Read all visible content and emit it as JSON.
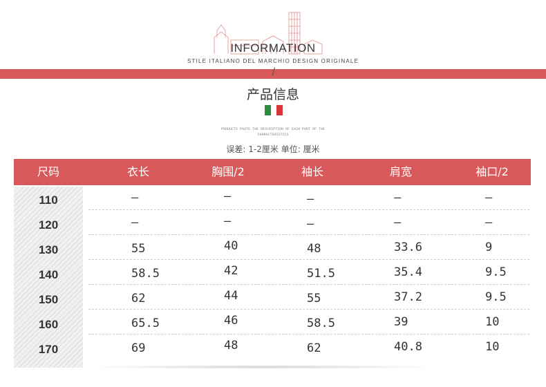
{
  "header": {
    "title": "INFORMATION",
    "subtitle": "STILE ITALIANO DEL MARCHIO DESIGN ORIGINALE",
    "slash": "/",
    "section_title": "产品信息",
    "fine_print_line1": "PRODUCTS PASTE THE DESCRIPTION OF EACH PART OF THE",
    "fine_print_line2": "CHARACTERISTICS",
    "tolerance_note": "误差: 1-2厘米  单位: 厘米",
    "flag_colors": [
      "#2e8b3e",
      "#ffffff",
      "#d6363a"
    ],
    "landmark_icon": "leaning-tower-landmark-icon"
  },
  "colors": {
    "accent": "#d9585a",
    "header_text": "#ffffff"
  },
  "table": {
    "columns": [
      "尺码",
      "衣长",
      "胸围/2",
      "袖长",
      "肩宽",
      "袖口/2"
    ],
    "rows": [
      [
        "110",
        "—",
        "—",
        "—",
        "—",
        "—"
      ],
      [
        "120",
        "—",
        "—",
        "—",
        "—",
        "—"
      ],
      [
        "130",
        "55",
        "40",
        "48",
        "33.6",
        "9"
      ],
      [
        "140",
        "58.5",
        "42",
        "51.5",
        "35.4",
        "9.5"
      ],
      [
        "150",
        "62",
        "44",
        "55",
        "37.2",
        "9.5"
      ],
      [
        "160",
        "65.5",
        "46",
        "58.5",
        "39",
        "10"
      ],
      [
        "170",
        "69",
        "48",
        "62",
        "40.8",
        "10"
      ]
    ]
  }
}
